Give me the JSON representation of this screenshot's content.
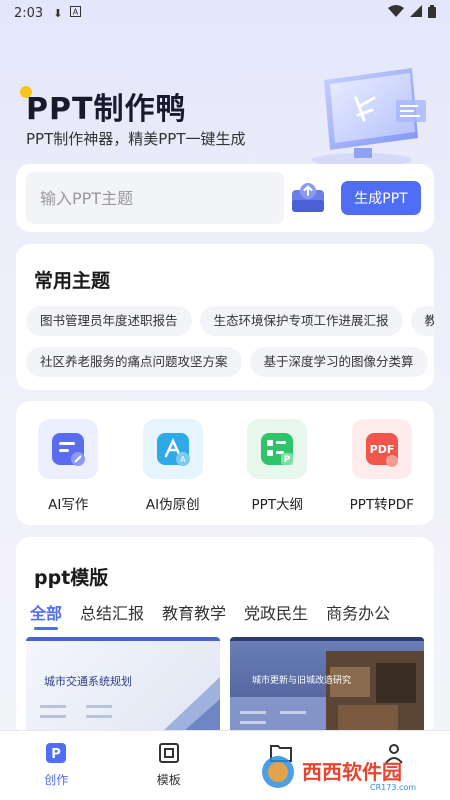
{
  "status_bar": {
    "time": "2:03"
  },
  "hero": {
    "title": "PPT制作鸭",
    "subtitle": "PPT制作神器，精美PPT一键生成"
  },
  "search": {
    "placeholder": "输入PPT主题",
    "generate_label": "生成PPT"
  },
  "topics": {
    "title": "常用主题",
    "row1": [
      "图书管理员年度述职报告",
      "生态环境保护专项工作进展汇报",
      "教"
    ],
    "row2": [
      "社区养老服务的痛点问题攻坚方案",
      "基于深度学习的图像分类算"
    ]
  },
  "tools": [
    {
      "label": "AI写作",
      "icon": "ai-writing-icon",
      "color": "#5b6cf0"
    },
    {
      "label": "AI伪原创",
      "icon": "ai-rewrite-icon",
      "color": "#2fa9e8"
    },
    {
      "label": "PPT大纲",
      "icon": "ppt-outline-icon",
      "color": "#2fc46b"
    },
    {
      "label": "PPT转PDF",
      "icon": "ppt-to-pdf-icon",
      "color": "#f0564e"
    }
  ],
  "templates": {
    "title": "ppt模版",
    "tabs": [
      "全部",
      "总结汇报",
      "教育教学",
      "党政民生",
      "商务办公"
    ],
    "active_tab": "全部",
    "items": [
      {
        "title": "城市交通系统规划"
      },
      {
        "title": "城市更新与旧城改造研究"
      }
    ]
  },
  "bottom_nav": [
    {
      "label": "创作",
      "icon": "create-icon",
      "active": true
    },
    {
      "label": "模板",
      "icon": "template-icon",
      "active": false
    },
    {
      "label": "",
      "icon": "folder-icon",
      "active": false
    },
    {
      "label": "",
      "icon": "profile-icon",
      "active": false
    }
  ],
  "watermark": {
    "text": "西西软件园",
    "sub": "CR173.com"
  },
  "colors": {
    "accent": "#4f6ef5"
  }
}
